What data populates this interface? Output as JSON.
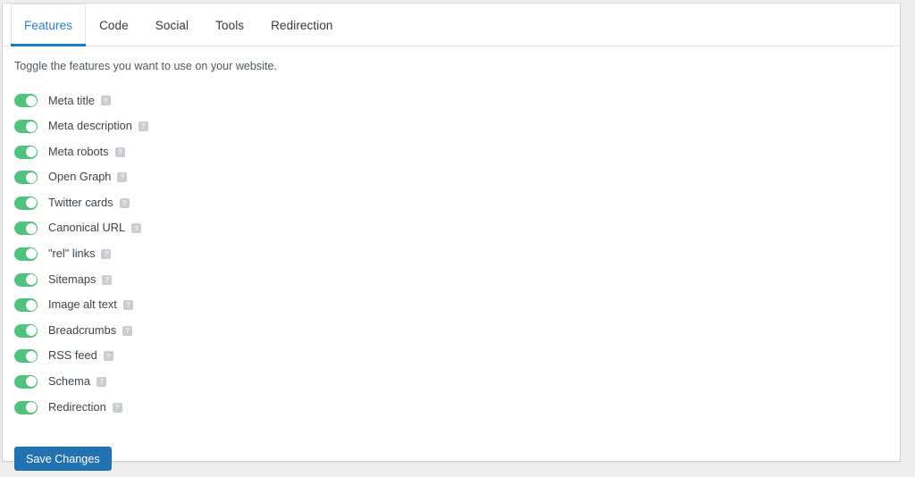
{
  "colors": {
    "page_background": "#eeeeee",
    "card_background": "#ffffff",
    "active_tab": "#2a7fc0",
    "tab_underline": "#1a7fc1",
    "toggle_on": "#52c27f",
    "button_blue": "#2271b1",
    "label_text": "#3c434a"
  },
  "tabs": [
    {
      "label": "Features",
      "active": true
    },
    {
      "label": "Code",
      "active": false
    },
    {
      "label": "Social",
      "active": false
    },
    {
      "label": "Tools",
      "active": false
    },
    {
      "label": "Redirection",
      "active": false
    }
  ],
  "panel": {
    "intro": "Toggle the features you want to use on your website.",
    "help_glyph": "?",
    "help_icon_name": "help-icon"
  },
  "features": [
    {
      "label": "Meta title",
      "enabled": true
    },
    {
      "label": "Meta description",
      "enabled": true
    },
    {
      "label": "Meta robots",
      "enabled": true
    },
    {
      "label": "Open Graph",
      "enabled": true
    },
    {
      "label": "Twitter cards",
      "enabled": true
    },
    {
      "label": "Canonical URL",
      "enabled": true
    },
    {
      "label": "\"rel\" links",
      "enabled": true
    },
    {
      "label": "Sitemaps",
      "enabled": true
    },
    {
      "label": "Image alt text",
      "enabled": true
    },
    {
      "label": "Breadcrumbs",
      "enabled": true
    },
    {
      "label": "RSS feed",
      "enabled": true
    },
    {
      "label": "Schema",
      "enabled": true
    },
    {
      "label": "Redirection",
      "enabled": true
    }
  ],
  "actions": {
    "save_label": "Save Changes"
  }
}
